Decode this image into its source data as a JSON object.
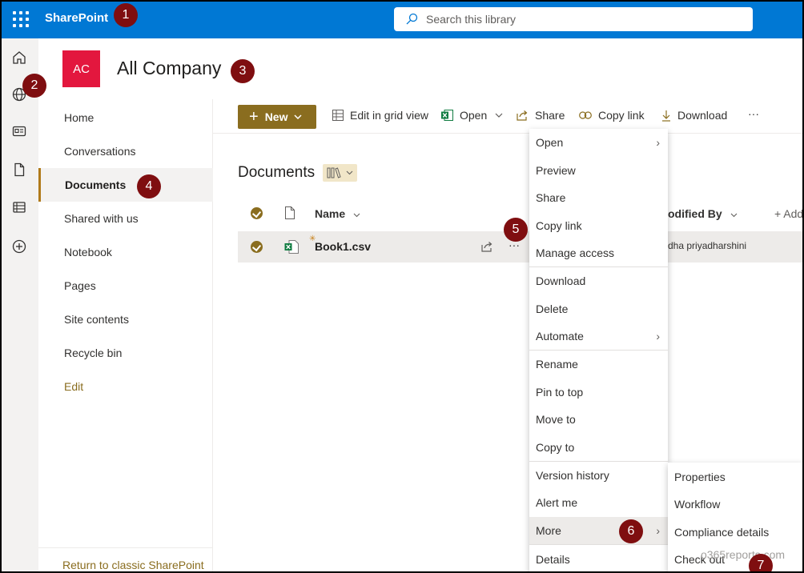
{
  "suite": {
    "app_name": "SharePoint",
    "search_placeholder": "Search this library"
  },
  "markers": [
    "1",
    "2",
    "3",
    "4",
    "5",
    "6",
    "7"
  ],
  "appbar": {
    "icons": [
      "home-icon",
      "globe-icon",
      "news-icon",
      "file-icon",
      "lists-icon",
      "add-circle-icon"
    ]
  },
  "site": {
    "logo": "AC",
    "title": "All Company"
  },
  "leftnav": {
    "items": [
      "Home",
      "Conversations",
      "Documents",
      "Shared with us",
      "Notebook",
      "Pages",
      "Site contents",
      "Recycle bin",
      "Edit"
    ],
    "selected": "Documents",
    "footer": "Return to classic SharePoint"
  },
  "commandbar": {
    "new": "New",
    "edit_grid": "Edit in grid view",
    "open": "Open",
    "share": "Share",
    "copy_link": "Copy link",
    "download": "Download",
    "more": "···"
  },
  "library": {
    "title": "Documents",
    "columns": {
      "name": "Name",
      "modified_by": "odified By",
      "add": "+ Add"
    },
    "rows": [
      {
        "name": "Book1.csv",
        "modified_by": "dha priyadharshini"
      }
    ],
    "row_more": "···"
  },
  "context_menu": {
    "items": [
      "Open",
      "Preview",
      "Share",
      "Copy link",
      "Manage access",
      "Download",
      "Delete",
      "Automate",
      "Rename",
      "Pin to top",
      "Move to",
      "Copy to",
      "Version history",
      "Alert me",
      "More",
      "Details"
    ],
    "hovered": "More"
  },
  "submenu": {
    "items": [
      "Properties",
      "Workflow",
      "Compliance details",
      "Check out"
    ]
  },
  "watermark": "o365reports.com",
  "colors": {
    "suite": "#0078d4",
    "accent": "#8a6d1f",
    "site_logo": "#e3173e",
    "marker": "#7f0e10"
  }
}
